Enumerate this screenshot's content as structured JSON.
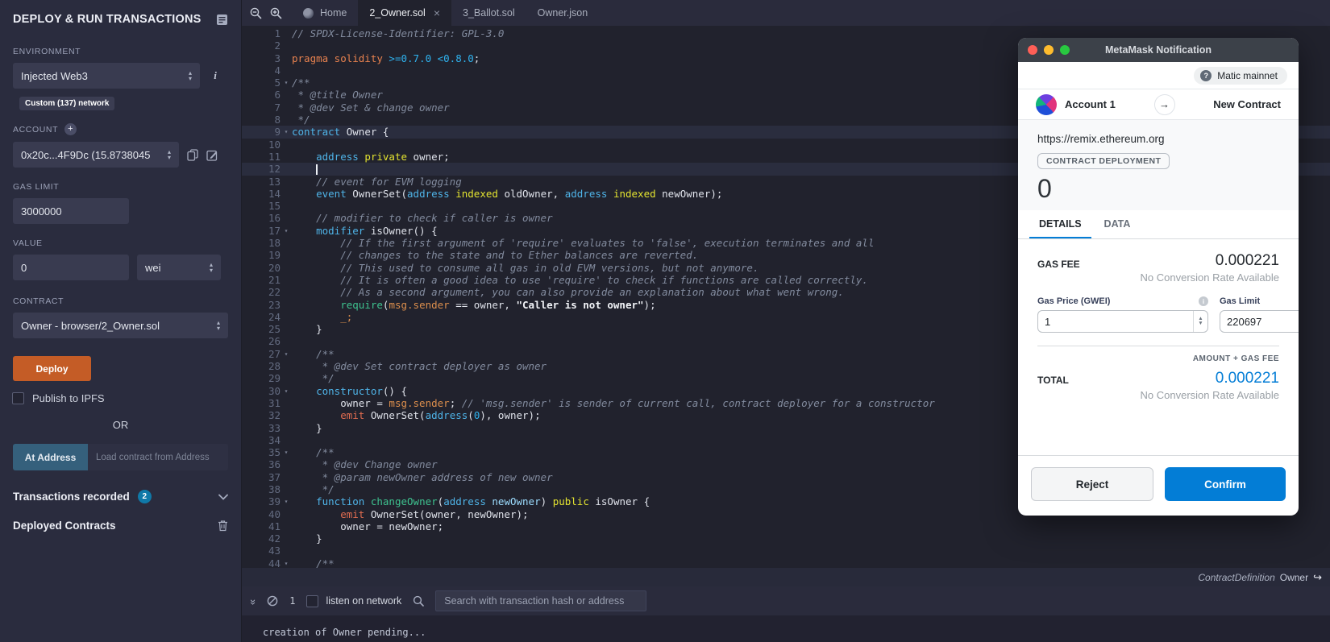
{
  "colors": {
    "deploy_orange": "#c45c26",
    "at_address_blue": "#35607c",
    "badge_teal": "#1079a8",
    "metamask_blue": "#037dd6",
    "editor_bg": "#21222d",
    "panel_bg": "#2a2c3e"
  },
  "left_panel": {
    "title": "DEPLOY & RUN TRANSACTIONS",
    "environment": {
      "label": "ENVIRONMENT",
      "value": "Injected Web3",
      "badge": "Custom (137) network"
    },
    "account": {
      "label": "ACCOUNT",
      "value": "0x20c...4F9Dc (15.8738045"
    },
    "gas_limit": {
      "label": "GAS LIMIT",
      "value": "3000000"
    },
    "value": {
      "label": "VALUE",
      "amount": "0",
      "unit": "wei"
    },
    "contract": {
      "label": "CONTRACT",
      "value": "Owner - browser/2_Owner.sol"
    },
    "deploy_label": "Deploy",
    "publish_label": "Publish to IPFS",
    "or_label": "OR",
    "at_address_label": "At Address",
    "at_address_placeholder": "Load contract from Address",
    "transactions_recorded": {
      "label": "Transactions recorded",
      "count": "2"
    },
    "deployed_contracts_label": "Deployed Contracts"
  },
  "editor": {
    "tabs": [
      {
        "label": "Home"
      },
      {
        "label": "2_Owner.sol"
      },
      {
        "label": "3_Ballot.sol"
      },
      {
        "label": "Owner.json"
      }
    ],
    "status_bar": {
      "node_type": "ContractDefinition",
      "node_name": "Owner"
    },
    "lines": [
      {
        "n": 1,
        "t": [
          [
            "cm",
            "// SPDX-License-Identifier: GPL-3.0"
          ]
        ]
      },
      {
        "n": 2,
        "t": []
      },
      {
        "n": 3,
        "t": [
          [
            "kw2",
            "pragma solidity "
          ],
          [
            "num",
            ">=0.7.0 <0.8.0"
          ],
          [
            "pl",
            ";"
          ]
        ]
      },
      {
        "n": 4,
        "t": []
      },
      {
        "n": 5,
        "fold": true,
        "t": [
          [
            "cm",
            "/**"
          ]
        ]
      },
      {
        "n": 6,
        "t": [
          [
            "cm",
            " * @title Owner"
          ]
        ]
      },
      {
        "n": 7,
        "t": [
          [
            "cm",
            " * @dev Set & change owner"
          ]
        ]
      },
      {
        "n": 8,
        "t": [
          [
            "cm",
            " */"
          ]
        ]
      },
      {
        "n": 9,
        "fold": true,
        "hl": true,
        "t": [
          [
            "kw",
            "contract"
          ],
          [
            "pl",
            " Owner {"
          ]
        ]
      },
      {
        "n": 10,
        "t": []
      },
      {
        "n": 11,
        "t": [
          [
            "pl",
            "    "
          ],
          [
            "kw",
            "address"
          ],
          [
            "pl",
            " "
          ],
          [
            "yl",
            "private"
          ],
          [
            "pl",
            " owner;"
          ]
        ]
      },
      {
        "n": 12,
        "hl": true,
        "t": [
          [
            "pl",
            "    "
          ],
          [
            "cursor",
            ""
          ]
        ]
      },
      {
        "n": 13,
        "t": [
          [
            "pl",
            "    "
          ],
          [
            "cm",
            "// event for EVM logging"
          ]
        ]
      },
      {
        "n": 14,
        "t": [
          [
            "pl",
            "    "
          ],
          [
            "kw",
            "event"
          ],
          [
            "pl",
            " OwnerSet("
          ],
          [
            "kw",
            "address"
          ],
          [
            "pl",
            " "
          ],
          [
            "yl",
            "indexed"
          ],
          [
            "pl",
            " oldOwner, "
          ],
          [
            "kw",
            "address"
          ],
          [
            "pl",
            " "
          ],
          [
            "yl",
            "indexed"
          ],
          [
            "pl",
            " newOwner);"
          ]
        ]
      },
      {
        "n": 15,
        "t": []
      },
      {
        "n": 16,
        "t": [
          [
            "pl",
            "    "
          ],
          [
            "cm",
            "// modifier to check if caller is owner"
          ]
        ]
      },
      {
        "n": 17,
        "fold": true,
        "t": [
          [
            "pl",
            "    "
          ],
          [
            "kw",
            "modifier"
          ],
          [
            "pl",
            " isOwner() {"
          ]
        ]
      },
      {
        "n": 18,
        "t": [
          [
            "pl",
            "        "
          ],
          [
            "cm",
            "// If the first argument of 'require' evaluates to 'false', execution terminates and all"
          ]
        ]
      },
      {
        "n": 19,
        "t": [
          [
            "pl",
            "        "
          ],
          [
            "cm",
            "// changes to the state and to Ether balances are reverted."
          ]
        ]
      },
      {
        "n": 20,
        "t": [
          [
            "pl",
            "        "
          ],
          [
            "cm",
            "// This used to consume all gas in old EVM versions, but not anymore."
          ]
        ]
      },
      {
        "n": 21,
        "t": [
          [
            "pl",
            "        "
          ],
          [
            "cm",
            "// It is often a good idea to use 'require' to check if functions are called correctly."
          ]
        ]
      },
      {
        "n": 22,
        "t": [
          [
            "pl",
            "        "
          ],
          [
            "cm",
            "// As a second argument, you can also provide an explanation about what went wrong."
          ]
        ]
      },
      {
        "n": 23,
        "t": [
          [
            "pl",
            "        "
          ],
          [
            "fn",
            "require"
          ],
          [
            "pl",
            "("
          ],
          [
            "or",
            "msg.sender"
          ],
          [
            "pl",
            " == owner, "
          ],
          [
            "str",
            "\"Caller is not owner\""
          ],
          [
            "pl",
            ");"
          ]
        ]
      },
      {
        "n": 24,
        "t": [
          [
            "pl",
            "        "
          ],
          [
            "or",
            "_;"
          ]
        ]
      },
      {
        "n": 25,
        "t": [
          [
            "pl",
            "    }"
          ]
        ]
      },
      {
        "n": 26,
        "t": []
      },
      {
        "n": 27,
        "fold": true,
        "t": [
          [
            "pl",
            "    "
          ],
          [
            "cm",
            "/**"
          ]
        ]
      },
      {
        "n": 28,
        "t": [
          [
            "pl",
            "    "
          ],
          [
            "cm",
            " * @dev Set contract deployer as owner"
          ]
        ]
      },
      {
        "n": 29,
        "t": [
          [
            "pl",
            "    "
          ],
          [
            "cm",
            " */"
          ]
        ]
      },
      {
        "n": 30,
        "fold": true,
        "t": [
          [
            "pl",
            "    "
          ],
          [
            "kw",
            "constructor"
          ],
          [
            "pl",
            "() {"
          ]
        ]
      },
      {
        "n": 31,
        "t": [
          [
            "pl",
            "        owner = "
          ],
          [
            "or",
            "msg.sender"
          ],
          [
            "pl",
            "; "
          ],
          [
            "cm",
            "// 'msg.sender' is sender of current call, contract deployer for a constructor"
          ]
        ]
      },
      {
        "n": 32,
        "t": [
          [
            "pl",
            "        "
          ],
          [
            "or2",
            "emit"
          ],
          [
            "pl",
            " OwnerSet("
          ],
          [
            "kw",
            "address"
          ],
          [
            "pl",
            "("
          ],
          [
            "num",
            "0"
          ],
          [
            "pl",
            "), owner);"
          ]
        ]
      },
      {
        "n": 33,
        "t": [
          [
            "pl",
            "    }"
          ]
        ]
      },
      {
        "n": 34,
        "t": []
      },
      {
        "n": 35,
        "fold": true,
        "t": [
          [
            "pl",
            "    "
          ],
          [
            "cm",
            "/**"
          ]
        ]
      },
      {
        "n": 36,
        "t": [
          [
            "pl",
            "    "
          ],
          [
            "cm",
            " * @dev Change owner"
          ]
        ]
      },
      {
        "n": 37,
        "t": [
          [
            "pl",
            "    "
          ],
          [
            "cm",
            " * @param newOwner address of new owner"
          ]
        ]
      },
      {
        "n": 38,
        "t": [
          [
            "pl",
            "    "
          ],
          [
            "cm",
            " */"
          ]
        ]
      },
      {
        "n": 39,
        "fold": true,
        "t": [
          [
            "pl",
            "    "
          ],
          [
            "kw",
            "function"
          ],
          [
            "pl",
            " "
          ],
          [
            "fn",
            "changeOwner"
          ],
          [
            "pl",
            "("
          ],
          [
            "kw",
            "address"
          ],
          [
            "pl",
            " "
          ],
          [
            "var",
            "newOwner"
          ],
          [
            "pl",
            ") "
          ],
          [
            "yl",
            "public"
          ],
          [
            "pl",
            " isOwner {"
          ]
        ]
      },
      {
        "n": 40,
        "t": [
          [
            "pl",
            "        "
          ],
          [
            "or2",
            "emit"
          ],
          [
            "pl",
            " OwnerSet(owner, newOwner);"
          ]
        ]
      },
      {
        "n": 41,
        "t": [
          [
            "pl",
            "        owner = newOwner;"
          ]
        ]
      },
      {
        "n": 42,
        "t": [
          [
            "pl",
            "    }"
          ]
        ]
      },
      {
        "n": 43,
        "t": []
      },
      {
        "n": 44,
        "fold": true,
        "t": [
          [
            "pl",
            "    "
          ],
          [
            "cm",
            "/**"
          ]
        ]
      }
    ]
  },
  "terminal": {
    "block_count": "1",
    "listen_label": "listen on network",
    "search_placeholder": "Search with transaction hash or address",
    "log": "creation of Owner pending..."
  },
  "metamask": {
    "window_title": "MetaMask Notification",
    "network_badge": "Matic mainnet",
    "from_account": "Account 1",
    "to_label": "New Contract",
    "origin": "https://remix.ethereum.org",
    "tx_type": "CONTRACT DEPLOYMENT",
    "amount": "0",
    "tabs": {
      "details": "DETAILS",
      "data": "DATA"
    },
    "gas_fee": {
      "label": "GAS FEE",
      "value": "0.000221",
      "conversion": "No Conversion Rate Available"
    },
    "gas_price": {
      "label": "Gas Price (GWEI)",
      "value": "1"
    },
    "gas_limit": {
      "label": "Gas Limit",
      "value": "220697"
    },
    "amount_gas_fee_label": "AMOUNT + GAS FEE",
    "total": {
      "label": "TOTAL",
      "value": "0.000221",
      "conversion": "No Conversion Rate Available"
    },
    "reject_label": "Reject",
    "confirm_label": "Confirm"
  }
}
